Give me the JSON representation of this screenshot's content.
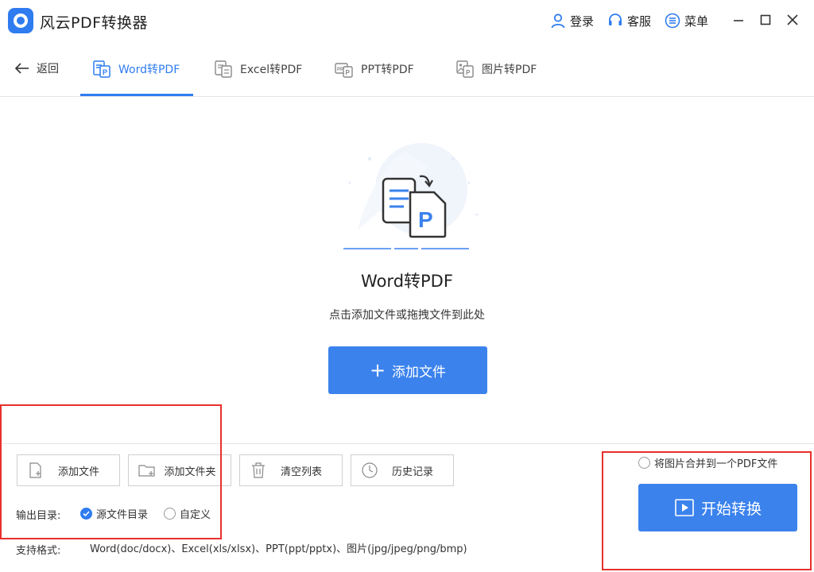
{
  "app": {
    "title": "风云PDF转换器"
  },
  "titlebar": {
    "login": "登录",
    "service": "客服",
    "menu": "菜单"
  },
  "nav": {
    "back": "返回",
    "tabs": [
      {
        "label": "Word转PDF",
        "active": true
      },
      {
        "label": "Excel转PDF",
        "active": false
      },
      {
        "label": "PPT转PDF",
        "active": false
      },
      {
        "label": "图片转PDF",
        "active": false
      }
    ]
  },
  "main": {
    "title": "Word转PDF",
    "hint": "点击添加文件或拖拽文件到此处",
    "add_button": "添加文件"
  },
  "toolbar": {
    "add_file": "添加文件",
    "add_folder": "添加文件夹",
    "clear_list": "清空列表",
    "history": "历史记录"
  },
  "output": {
    "label": "输出目录:",
    "source_dir": "源文件目录",
    "custom": "自定义",
    "selected": "源文件目录"
  },
  "formats": {
    "label": "支持格式:",
    "text": "Word(doc/docx)、Excel(xls/xlsx)、PPT(ppt/pptx)、图片(jpg/jpeg/png/bmp)"
  },
  "merge": {
    "label": "将图片合并到一个PDF文件",
    "checked": false
  },
  "start": {
    "label": "开始转换"
  },
  "colors": {
    "accent": "#2f7cf0",
    "button": "#3b82ed",
    "highlight": "#e8302c"
  }
}
